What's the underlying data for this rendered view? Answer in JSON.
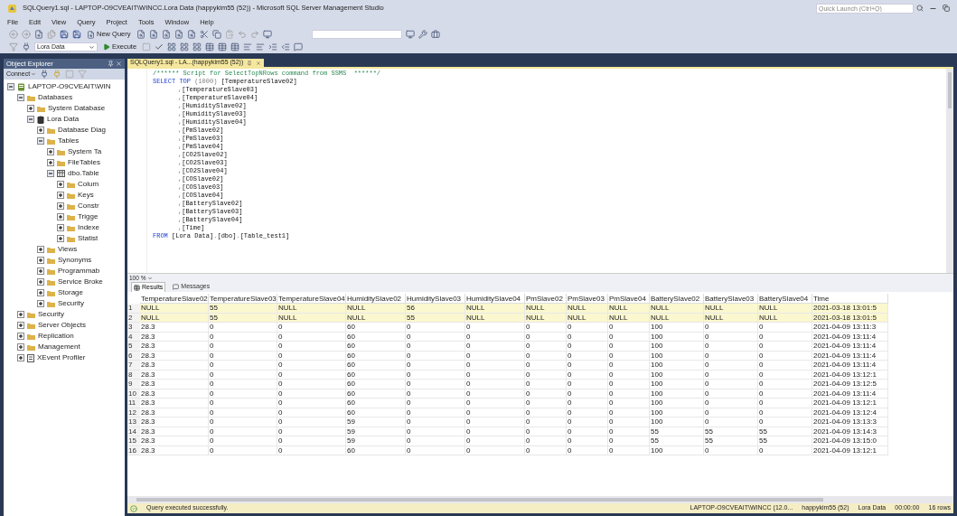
{
  "window": {
    "title": "SQLQuery1.sql - LAPTOP-O9CVEAIT\\WINCC.Lora Data (happykim55 (52)) - Microsoft SQL Server Management Studio",
    "quick_launch": {
      "placeholder": "Quick Launch (Ctrl+Q)"
    }
  },
  "menu": [
    "File",
    "Edit",
    "View",
    "Query",
    "Project",
    "Tools",
    "Window",
    "Help"
  ],
  "toolbar": {
    "new_query": "New Query",
    "database": "Lora Data",
    "execute": "Execute"
  },
  "explorer": {
    "title": "Object Explorer",
    "connect": "Connect",
    "tree": [
      {
        "label": "LAPTOP-O9CVEAIT\\WIN",
        "kind": "server",
        "expanded": true,
        "children": [
          {
            "label": "Databases",
            "kind": "folder",
            "expanded": true,
            "children": [
              {
                "label": "System Database",
                "kind": "folder",
                "expanded": false
              },
              {
                "label": "Lora Data",
                "kind": "database",
                "expanded": true,
                "children": [
                  {
                    "label": "Database Diag",
                    "kind": "folder",
                    "expanded": false
                  },
                  {
                    "label": "Tables",
                    "kind": "folder",
                    "expanded": true,
                    "children": [
                      {
                        "label": "System Ta",
                        "kind": "folder",
                        "expanded": false
                      },
                      {
                        "label": "FileTables",
                        "kind": "folder",
                        "expanded": false
                      },
                      {
                        "label": "dbo.Table",
                        "kind": "table",
                        "expanded": true,
                        "children": [
                          {
                            "label": "Colum",
                            "kind": "folder",
                            "expanded": false
                          },
                          {
                            "label": "Keys",
                            "kind": "folder",
                            "expanded": false
                          },
                          {
                            "label": "Constr",
                            "kind": "folder",
                            "expanded": false
                          },
                          {
                            "label": "Trigge",
                            "kind": "folder",
                            "expanded": false
                          },
                          {
                            "label": "Indexe",
                            "kind": "folder",
                            "expanded": false
                          },
                          {
                            "label": "Statist",
                            "kind": "folder",
                            "expanded": false
                          }
                        ]
                      }
                    ]
                  },
                  {
                    "label": "Views",
                    "kind": "folder",
                    "expanded": false
                  },
                  {
                    "label": "Synonyms",
                    "kind": "folder",
                    "expanded": false
                  },
                  {
                    "label": "Programmab",
                    "kind": "folder",
                    "expanded": false
                  },
                  {
                    "label": "Service Broke",
                    "kind": "folder",
                    "expanded": false
                  },
                  {
                    "label": "Storage",
                    "kind": "folder",
                    "expanded": false
                  },
                  {
                    "label": "Security",
                    "kind": "folder",
                    "expanded": false
                  }
                ]
              }
            ]
          },
          {
            "label": "Security",
            "kind": "folder",
            "expanded": false
          },
          {
            "label": "Server Objects",
            "kind": "folder",
            "expanded": false
          },
          {
            "label": "Replication",
            "kind": "folder",
            "expanded": false
          },
          {
            "label": "Management",
            "kind": "folder",
            "expanded": false
          },
          {
            "label": "XEvent Profiler",
            "kind": "xevent",
            "expanded": false
          }
        ]
      }
    ]
  },
  "editor": {
    "tab": "SQLQuery1.sql - LA...(happykim55 (52))",
    "lines": [
      [
        {
          "text": "/****** Script for SelectTopNRows command from SSMS  ******/",
          "kind": "comment"
        }
      ],
      [
        {
          "text": "SELECT TOP ",
          "kind": "keyword"
        },
        {
          "text": "(1000) ",
          "kind": "punct"
        },
        {
          "text": "[TemperatureSlave02]",
          "kind": "ident"
        }
      ],
      [
        {
          "text": ",",
          "kind": "punct"
        },
        {
          "text": "[TemperatureSlave03]",
          "kind": "ident"
        }
      ],
      [
        {
          "text": ",",
          "kind": "punct"
        },
        {
          "text": "[TemperatureSlave04]",
          "kind": "ident"
        }
      ],
      [
        {
          "text": ",",
          "kind": "punct"
        },
        {
          "text": "[HumiditySlave02]",
          "kind": "ident"
        }
      ],
      [
        {
          "text": ",",
          "kind": "punct"
        },
        {
          "text": "[HumiditySlave03]",
          "kind": "ident"
        }
      ],
      [
        {
          "text": ",",
          "kind": "punct"
        },
        {
          "text": "[HumiditySlave04]",
          "kind": "ident"
        }
      ],
      [
        {
          "text": ",",
          "kind": "punct"
        },
        {
          "text": "[PmSlave02]",
          "kind": "ident"
        }
      ],
      [
        {
          "text": ",",
          "kind": "punct"
        },
        {
          "text": "[PmSlave03]",
          "kind": "ident"
        }
      ],
      [
        {
          "text": ",",
          "kind": "punct"
        },
        {
          "text": "[PmSlave04]",
          "kind": "ident"
        }
      ],
      [
        {
          "text": ",",
          "kind": "punct"
        },
        {
          "text": "[CO2Slave02]",
          "kind": "ident"
        }
      ],
      [
        {
          "text": ",",
          "kind": "punct"
        },
        {
          "text": "[CO2Slave03]",
          "kind": "ident"
        }
      ],
      [
        {
          "text": ",",
          "kind": "punct"
        },
        {
          "text": "[CO2Slave04]",
          "kind": "ident"
        }
      ],
      [
        {
          "text": ",",
          "kind": "punct"
        },
        {
          "text": "[COSlave02]",
          "kind": "ident"
        }
      ],
      [
        {
          "text": ",",
          "kind": "punct"
        },
        {
          "text": "[COSlave03]",
          "kind": "ident"
        }
      ],
      [
        {
          "text": ",",
          "kind": "punct"
        },
        {
          "text": "[COSlave04]",
          "kind": "ident"
        }
      ],
      [
        {
          "text": ",",
          "kind": "punct"
        },
        {
          "text": "[BatterySlave02]",
          "kind": "ident"
        }
      ],
      [
        {
          "text": ",",
          "kind": "punct"
        },
        {
          "text": "[BatterySlave03]",
          "kind": "ident"
        }
      ],
      [
        {
          "text": ",",
          "kind": "punct"
        },
        {
          "text": "[BatterySlave04]",
          "kind": "ident"
        }
      ],
      [
        {
          "text": ",",
          "kind": "punct"
        },
        {
          "text": "[Time]",
          "kind": "ident"
        }
      ],
      [
        {
          "text": "FROM ",
          "kind": "keyword"
        },
        {
          "text": "[Lora Data]",
          "kind": "ident"
        },
        {
          "text": ".",
          "kind": "punct"
        },
        {
          "text": "[dbo]",
          "kind": "ident"
        },
        {
          "text": ".",
          "kind": "punct"
        },
        {
          "text": "[Table_test1]",
          "kind": "ident"
        }
      ]
    ],
    "zoom": "100 %"
  },
  "results": {
    "tabs": [
      {
        "label": "Results",
        "selected": true
      },
      {
        "label": "Messages",
        "selected": false
      }
    ],
    "columns": [
      "TemperatureSlave02",
      "TemperatureSlave03",
      "TemperatureSlave04",
      "HumiditySlave02",
      "HumiditySlave03",
      "HumiditySlave04",
      "PmSlave02",
      "PmSlave03",
      "PmSlave04",
      "BatterySlave02",
      "BatterySlave03",
      "BatterySlave04",
      "Time"
    ],
    "rows": [
      {
        "num": "1",
        "highlight": true,
        "cells": [
          "NULL",
          "55",
          "NULL",
          "NULL",
          "56",
          "NULL",
          "NULL",
          "NULL",
          "NULL",
          "NULL",
          "NULL",
          "NULL",
          "2021-03-18 13:01:5"
        ]
      },
      {
        "num": "2",
        "highlight": true,
        "cells": [
          "NULL",
          "55",
          "NULL",
          "NULL",
          "55",
          "NULL",
          "NULL",
          "NULL",
          "NULL",
          "NULL",
          "NULL",
          "NULL",
          "2021-03-18 13:01:5"
        ]
      },
      {
        "num": "3",
        "highlight": false,
        "cells": [
          "28.3",
          "0",
          "0",
          "60",
          "0",
          "0",
          "0",
          "0",
          "0",
          "100",
          "0",
          "0",
          "2021-04-09 13:11:3"
        ]
      },
      {
        "num": "4",
        "highlight": false,
        "cells": [
          "28.3",
          "0",
          "0",
          "60",
          "0",
          "0",
          "0",
          "0",
          "0",
          "100",
          "0",
          "0",
          "2021-04-09 13:11:4"
        ]
      },
      {
        "num": "5",
        "highlight": false,
        "cells": [
          "28.3",
          "0",
          "0",
          "60",
          "0",
          "0",
          "0",
          "0",
          "0",
          "100",
          "0",
          "0",
          "2021-04-09 13:11:4"
        ]
      },
      {
        "num": "6",
        "highlight": false,
        "cells": [
          "28.3",
          "0",
          "0",
          "60",
          "0",
          "0",
          "0",
          "0",
          "0",
          "100",
          "0",
          "0",
          "2021-04-09 13:11:4"
        ]
      },
      {
        "num": "7",
        "highlight": false,
        "cells": [
          "28.3",
          "0",
          "0",
          "60",
          "0",
          "0",
          "0",
          "0",
          "0",
          "100",
          "0",
          "0",
          "2021-04-09 13:11:4"
        ]
      },
      {
        "num": "8",
        "highlight": false,
        "cells": [
          "28.3",
          "0",
          "0",
          "60",
          "0",
          "0",
          "0",
          "0",
          "0",
          "100",
          "0",
          "0",
          "2021-04-09 13:12:1"
        ]
      },
      {
        "num": "9",
        "highlight": false,
        "cells": [
          "28.3",
          "0",
          "0",
          "60",
          "0",
          "0",
          "0",
          "0",
          "0",
          "100",
          "0",
          "0",
          "2021-04-09 13:12:5"
        ]
      },
      {
        "num": "10",
        "highlight": false,
        "cells": [
          "28.3",
          "0",
          "0",
          "60",
          "0",
          "0",
          "0",
          "0",
          "0",
          "100",
          "0",
          "0",
          "2021-04-09 13:11:4"
        ]
      },
      {
        "num": "11",
        "highlight": false,
        "cells": [
          "28.3",
          "0",
          "0",
          "60",
          "0",
          "0",
          "0",
          "0",
          "0",
          "100",
          "0",
          "0",
          "2021-04-09 13:12:1"
        ]
      },
      {
        "num": "12",
        "highlight": false,
        "cells": [
          "28.3",
          "0",
          "0",
          "60",
          "0",
          "0",
          "0",
          "0",
          "0",
          "100",
          "0",
          "0",
          "2021-04-09 13:12:4"
        ]
      },
      {
        "num": "13",
        "highlight": false,
        "cells": [
          "28.3",
          "0",
          "0",
          "59",
          "0",
          "0",
          "0",
          "0",
          "0",
          "100",
          "0",
          "0",
          "2021-04-09 13:13:3"
        ]
      },
      {
        "num": "14",
        "highlight": false,
        "cells": [
          "28.3",
          "0",
          "0",
          "59",
          "0",
          "0",
          "0",
          "0",
          "0",
          "55",
          "55",
          "55",
          "2021-04-09 13:14:3"
        ]
      },
      {
        "num": "15",
        "highlight": false,
        "cells": [
          "28.3",
          "0",
          "0",
          "59",
          "0",
          "0",
          "0",
          "0",
          "0",
          "55",
          "55",
          "55",
          "2021-04-09 13:15:0"
        ]
      },
      {
        "num": "16",
        "highlight": false,
        "cells": [
          "28.3",
          "0",
          "0",
          "60",
          "0",
          "0",
          "0",
          "0",
          "0",
          "100",
          "0",
          "0",
          "2021-04-09 13:12:1"
        ]
      }
    ]
  },
  "status_bar": {
    "message": "Query executed successfully.",
    "server": "LAPTOP-O9CVEAIT\\WINCC (12.0...",
    "user": "happykim55 (52)",
    "database": "Lora Data",
    "elapsed": "00:00:00",
    "rows": "16 rows"
  }
}
